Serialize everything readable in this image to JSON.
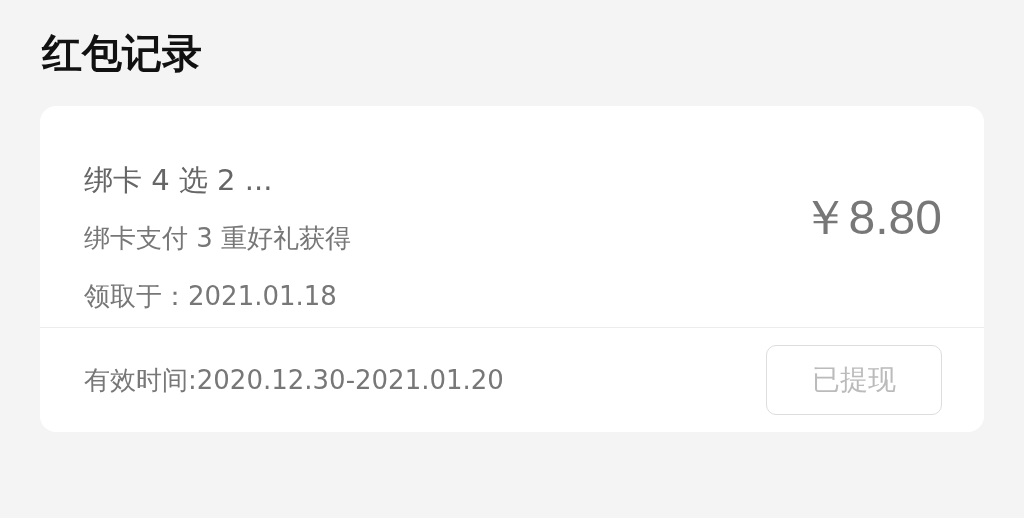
{
  "page": {
    "title": "红包记录"
  },
  "records": [
    {
      "name": "绑卡 4 选 2 ...",
      "source": "绑卡支付 3 重好礼获得",
      "received": "领取于：2021.01.18",
      "amount": "￥8.80",
      "validity": "有效时间:2020.12.30-2021.01.20",
      "button": {
        "label": "已提现",
        "disabled": true
      }
    }
  ]
}
